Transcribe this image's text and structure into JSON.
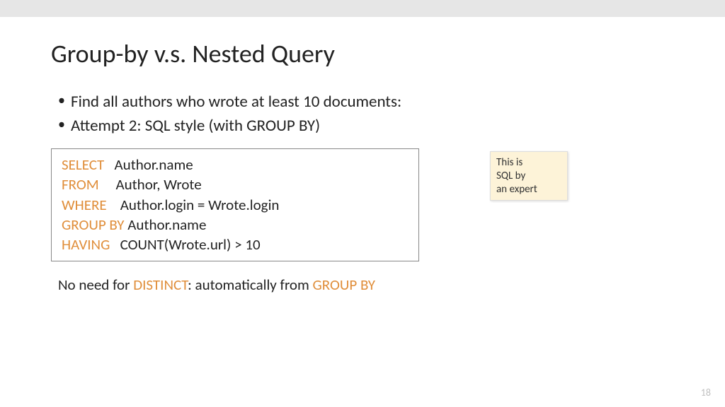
{
  "title": "Group-by v.s. Nested Query",
  "bullets": [
    "Find all authors who wrote at least 10 documents:",
    "Attempt 2: SQL style (with GROUP BY)"
  ],
  "code": {
    "lines": [
      {
        "kw": "SELECT",
        "pad": "   ",
        "rest": "Author.name"
      },
      {
        "kw": "FROM",
        "pad": "     ",
        "rest": "Author, Wrote"
      },
      {
        "kw": "WHERE",
        "pad": "    ",
        "rest": "Author.login = Wrote.login"
      },
      {
        "kw": "GROUP BY",
        "pad": " ",
        "rest": "Author.name"
      },
      {
        "kw": "HAVING",
        "pad": "   ",
        "rest": "COUNT(Wrote.url) > 10"
      }
    ]
  },
  "note": {
    "line1": "This is",
    "line2": "SQL  by",
    "line3": "an expert"
  },
  "footer": {
    "prefix": "No need for ",
    "kw1": "DISTINCT",
    "middle": ": automatically from ",
    "kw2": "GROUP BY"
  },
  "page_number": "18"
}
